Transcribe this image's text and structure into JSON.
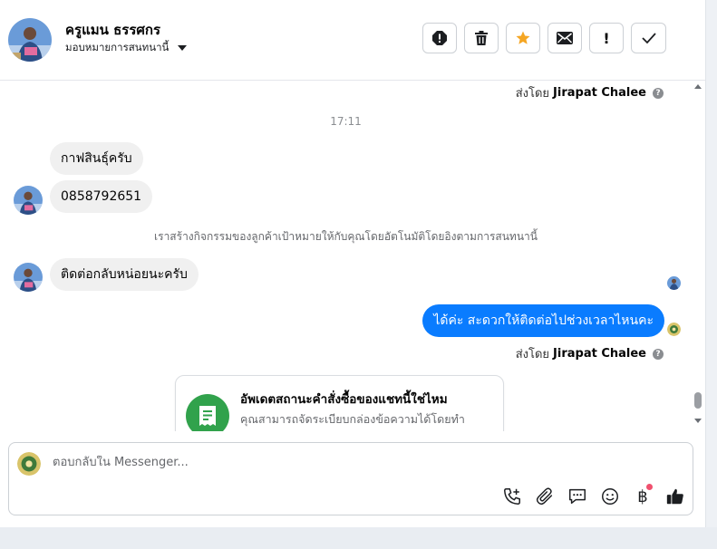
{
  "header": {
    "contact_name": "ครูแมน ธรรศกร",
    "assign_label": "มอบหมายการสนทนานี้",
    "actions": [
      {
        "icon": "spam-icon"
      },
      {
        "icon": "trash-icon"
      },
      {
        "icon": "star-icon",
        "color": "#f5a623"
      },
      {
        "icon": "envelope-icon"
      },
      {
        "icon": "exclamation-icon",
        "glyph": "!"
      },
      {
        "icon": "check-icon"
      }
    ]
  },
  "chat": {
    "sent_by_prefix": "ส่งโดย",
    "sent_by_name": "Jirapat Chalee",
    "timestamp": "17:11",
    "incoming_1": "กาฟสินธุ์ครับ",
    "incoming_2": "0858792651",
    "system_note": "เราสร้างกิจกรรมของลูกค้าเป้าหมายให้กับคุณโดยอัตโนมัติโดยอิงตามการสนทนานี้",
    "incoming_3": "ติดต่อกลับหน่อยนะครับ",
    "outgoing_1": "ได้ค่ะ  สะดวกให้ติดต่อไปช่วงเวลาไหนคะ",
    "outgoing_color": "#0a7cff",
    "card": {
      "title": "อัพเดตสถานะคำสั่งซื้อของแชทนี้ใช่ไหม",
      "description": "คุณสามารถจัดระเบียบกล่องข้อความได้โดยทำ",
      "icon_color": "#31a24c"
    }
  },
  "composer": {
    "placeholder": "ตอบกลับใน Messenger...",
    "value": "",
    "baht_glyph": "฿"
  }
}
